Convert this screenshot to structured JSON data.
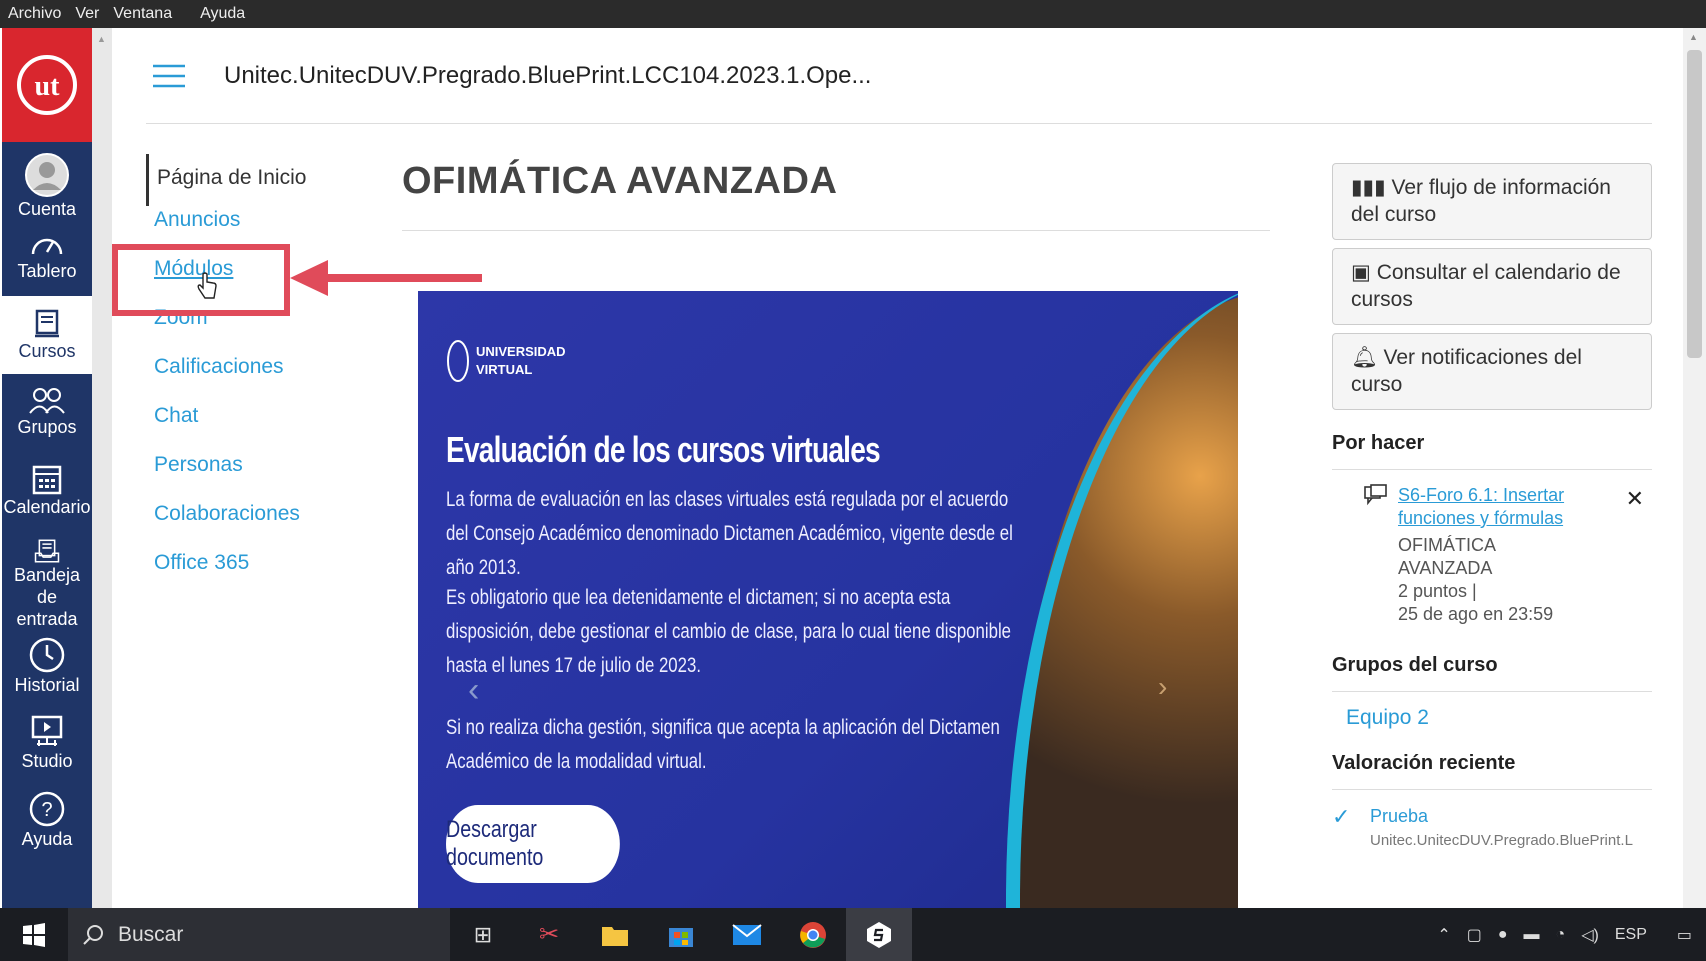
{
  "menubar": [
    "Archivo",
    "Ver",
    "Ventana",
    "Ayuda"
  ],
  "nav": {
    "logo_text": "ut",
    "items": [
      {
        "label": "Cuenta",
        "icon": "account-icon"
      },
      {
        "label": "Tablero",
        "icon": "dashboard-icon"
      },
      {
        "label": "Cursos",
        "icon": "courses-icon"
      },
      {
        "label": "Grupos",
        "icon": "groups-icon"
      },
      {
        "label": "Calendario",
        "icon": "calendar-icon"
      },
      {
        "label": "Bandeja de entrada",
        "icon": "inbox-icon"
      },
      {
        "label": "Historial",
        "icon": "history-icon"
      },
      {
        "label": "Studio",
        "icon": "studio-icon"
      },
      {
        "label": "Ayuda",
        "icon": "help-icon"
      }
    ]
  },
  "header": {
    "breadcrumb": "Unitec.UnitecDUV.Pregrado.BluePrint.LCC104.2023.1.Ope..."
  },
  "course_nav": [
    "Página de Inicio",
    "Anuncios",
    "Módulos",
    "Zoom",
    "Calificaciones",
    "Chat",
    "Personas",
    "Colaboraciones",
    "Office 365"
  ],
  "page_title": "OFIMÁTICA AVANZADA",
  "banner": {
    "logo_line1": "UNIVERSIDAD",
    "logo_line2": "VIRTUAL",
    "title": "Evaluación de los cursos virtuales",
    "p1": "La forma de evaluación en las clases virtuales está regulada por el acuerdo del Consejo Académico denominado Dictamen Académico, vigente desde el año 2013.",
    "p2": "Es obligatorio que lea detenidamente el dictamen; si no acepta esta disposición, debe gestionar el cambio de clase, para lo cual tiene disponible hasta el lunes 17 de julio de 2023.",
    "p3": "Si no realiza dicha gestión, significa que acepta la aplicación del Dictamen Académico de la modalidad virtual.",
    "button": "Descargar documento"
  },
  "sidebar": {
    "buttons": [
      "Ver flujo de información del curso",
      "Consultar el calendario de cursos",
      "Ver notificaciones del curso"
    ],
    "todo_heading": "Por hacer",
    "todo": {
      "link": "S6-Foro 6.1: Insertar funciones y fórmulas",
      "course": "OFIMÁTICA AVANZADA",
      "points": "2 puntos  |",
      "due": "25 de ago en 23:59",
      "close": "✕"
    },
    "groups_heading": "Grupos del curso",
    "group": "Equipo 2",
    "recent_heading": "Valoración reciente",
    "recent": {
      "name": "Prueba",
      "sub": "Unitec.UnitecDUV.Pregrado.BluePrint.L"
    }
  },
  "taskbar": {
    "search": "Buscar",
    "lang": "ESP"
  }
}
